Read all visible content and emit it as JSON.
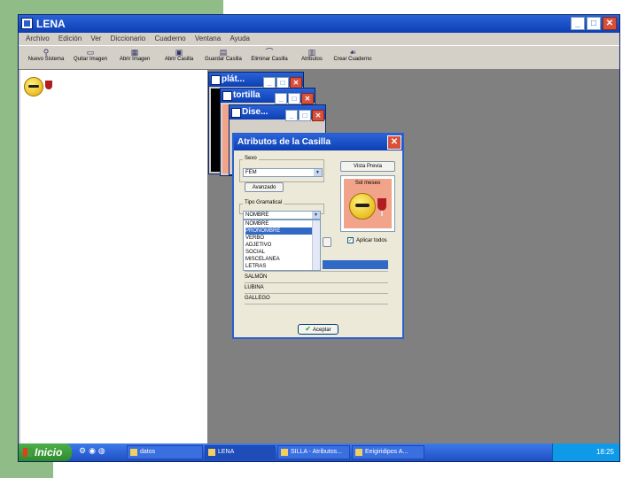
{
  "window": {
    "title": "LENA"
  },
  "menu": [
    "Archivo",
    "Edición",
    "Ver",
    "Diccionario",
    "Cuaderno",
    "Ventana",
    "Ayuda"
  ],
  "toolbar": [
    {
      "label": "Nuevo Sistema",
      "icon": "new-system-icon"
    },
    {
      "label": "Quitar Imagen",
      "icon": "remove-image-icon"
    },
    {
      "label": "Abrir Imagen",
      "icon": "open-image-icon"
    },
    {
      "label": "Abrir Casilla",
      "icon": "open-cell-icon"
    },
    {
      "label": "Guardar Casilla",
      "icon": "save-cell-icon"
    },
    {
      "label": "Eliminar Casilla",
      "icon": "delete-cell-icon"
    },
    {
      "label": "Atributos",
      "icon": "attributes-icon"
    },
    {
      "label": "Crear Cuaderno",
      "icon": "create-notebook-icon"
    }
  ],
  "child_windows": [
    {
      "title": "plát..."
    },
    {
      "title": "tortilla"
    },
    {
      "title": "Dise..."
    }
  ],
  "dialog": {
    "title": "Atributos de la Casilla",
    "sex_label": "Sexo",
    "sex_value": "FEM",
    "vista_previa": "Vista Previa",
    "preview_caption": "Sol meseo",
    "avanzado": "Avanzado",
    "tipo_label": "Tipo Gramatical",
    "tipo_value": "NOMBRE",
    "tipo_options": [
      "NOMBRE",
      "PRONOMBRE",
      "VERBO",
      "ADJETIVO",
      "SOCIAL",
      "MISCELANEA",
      "LETRAS"
    ],
    "selected_index": 1,
    "apply_label": "Aplicar todos",
    "word_items": [
      "SALMÓN",
      "LUBINA",
      "GALLEGO"
    ],
    "ok_label": "Aceptar"
  },
  "taskbar": {
    "start": "Inicio",
    "tasks": [
      "datos",
      "LENA",
      "SILLA - Atributos...",
      "Eeigiridipos A..."
    ],
    "clock": "18:25"
  },
  "colors": {
    "title_blue": "#0d3fb4",
    "desktop_green": "#8fbc87",
    "workspace_gray": "#808080",
    "selection": "#316ac5"
  }
}
